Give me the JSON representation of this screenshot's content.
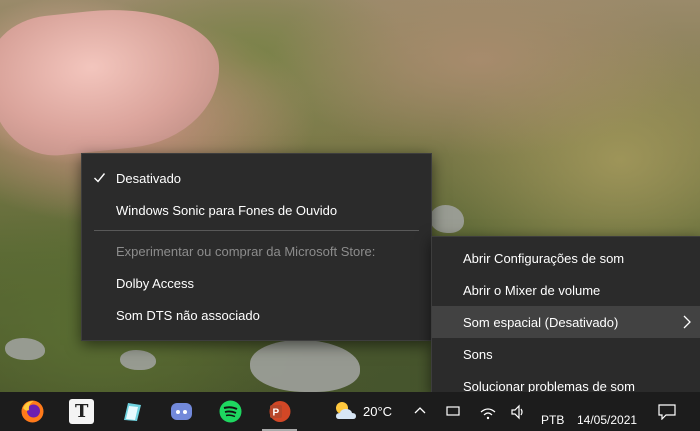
{
  "spatial_menu": {
    "items": [
      {
        "label": "Desativado",
        "checked": true
      },
      {
        "label": "Windows Sonic para Fones de Ouvido",
        "checked": false
      }
    ],
    "store_hint": "Experimentar ou comprar da Microsoft Store:",
    "store_items": [
      {
        "label": "Dolby Access"
      },
      {
        "label": "Som DTS não associado"
      }
    ]
  },
  "sound_menu": {
    "items": [
      {
        "label": "Abrir Configurações de som"
      },
      {
        "label": "Abrir o Mixer de volume"
      },
      {
        "label": "Som espacial (Desativado)",
        "has_submenu": true,
        "active": true
      },
      {
        "label": "Sons"
      },
      {
        "label": "Solucionar problemas de som"
      }
    ]
  },
  "taskbar": {
    "apps": [
      "firefox-icon",
      "typora-icon",
      "notepad-icon",
      "discord-icon",
      "spotify-icon",
      "powerpoint-icon"
    ],
    "typora_letter": "T",
    "weather": {
      "icon": "partly-cloudy-icon",
      "temp": "20°C"
    },
    "language": "PTB",
    "date": "14/05/2021"
  },
  "colors": {
    "menu_bg": "#2b2b2b",
    "menu_hover": "#424242",
    "taskbar_bg": "#1c1c1c"
  }
}
